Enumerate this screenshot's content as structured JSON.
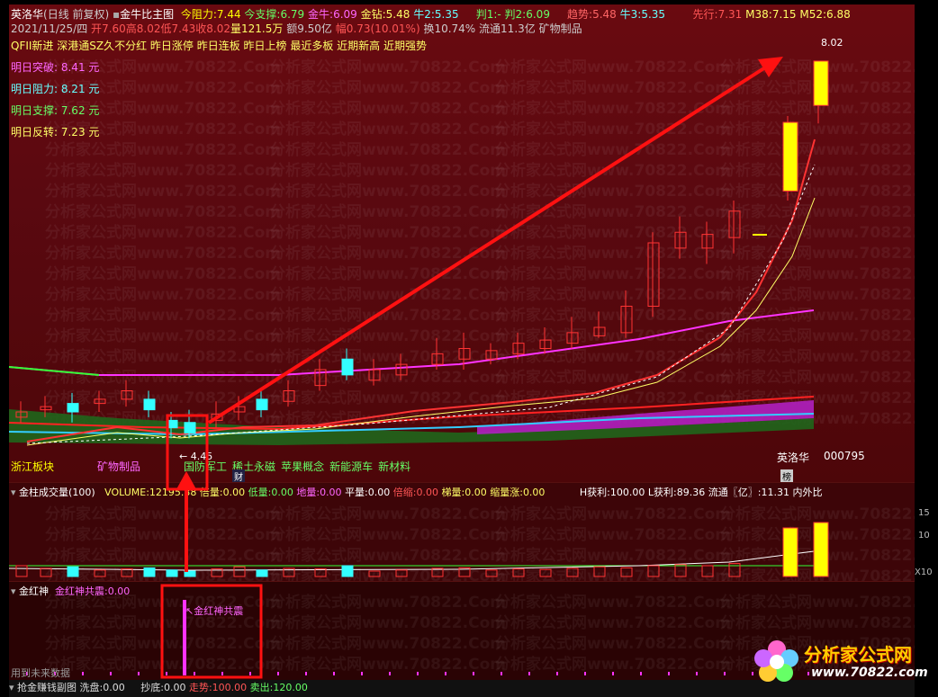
{
  "header": {
    "stock_name": "英洛华",
    "period": "(日线 前复权)",
    "indicator": "金牛比主图",
    "today_resist_label": "今阻力:",
    "today_resist": "7.44",
    "today_support_label": "今支撑:",
    "today_support": "6.79",
    "jinniu_label": "金牛:",
    "jinniu": "6.09",
    "jinzuan_label": "金钻:",
    "jinzuan": "5.48",
    "niu2_label": "牛2:",
    "niu2": "5.35",
    "pan1_label": "判1:",
    "pan1": "-",
    "pan2_label": "判2:",
    "pan2": "6.09",
    "trend_label": "趋势:",
    "trend": "5.48",
    "niu3_label": "牛3:",
    "niu3": "5.35",
    "xianxing_label": "先行:",
    "xianxing": "7.31",
    "m38_label": "M38:",
    "m38": "7.15",
    "m52_label": "M52:",
    "m52": "6.88"
  },
  "quote": {
    "date": "2021/11/25/四",
    "open_label": "开",
    "open": "7.60",
    "high_label": "高",
    "high": "8.02",
    "low_label": "低",
    "low": "7.43",
    "close_label": "收",
    "close": "8.02",
    "vol_label": "量",
    "vol": "121.5万",
    "amount_label": "额",
    "amount": "9.50亿",
    "change_label": "幅",
    "change": "0.73(10.01%)",
    "turnover": "换10.74%",
    "float": "流通11.3亿",
    "sector": "矿物制品"
  },
  "tags": "QFII新进 深港通SZ久不分红 昨日涨停 昨日连板 昨日上榜 最近多板 近期新高 近期强势",
  "levels": [
    {
      "label": "明日突破:",
      "value": "8.41 元",
      "color": "#ff66ff"
    },
    {
      "label": "明日阻力:",
      "value": "8.21 元",
      "color": "#66ffff"
    },
    {
      "label": "明日支撑:",
      "value": "7.62 元",
      "color": "#66ff66"
    },
    {
      "label": "明日反转:",
      "value": "7.23 元",
      "color": "#ffff66"
    }
  ],
  "chart_annot": {
    "price_high": "8.02",
    "low_marker": "← 4.45",
    "stock_tag": "英洛华",
    "stock_code": "000795",
    "badge_cai": "财",
    "badge_bang": "榜"
  },
  "sectors": [
    {
      "label": "浙江板块",
      "color": "#ffff00"
    },
    {
      "label": "矿物制品",
      "color": "#ff66ff"
    },
    {
      "label": "国防军工",
      "color": "#66ff66"
    },
    {
      "label": "稀土永磁",
      "color": "#66ff66"
    },
    {
      "label": "苹果概念",
      "color": "#66ff66"
    },
    {
      "label": "新能源车",
      "color": "#66ff66"
    },
    {
      "label": "新材料",
      "color": "#66ff66"
    }
  ],
  "volume_header": {
    "title": "金柱成交量(100)",
    "volume_label": "VOLUME:",
    "volume": "12195.38",
    "beiliang_label": "倍量:",
    "beiliang": "0.00",
    "diliang_label": "低量:",
    "diliang": "0.00",
    "diliang2_label": "地量:",
    "diliang2": "0.00",
    "pingliang_label": "平量:",
    "pingliang": "0.00",
    "beisuo_label": "倍缩:",
    "beisuo": "0.00",
    "tiliang_label": "梯量:",
    "tiliang": "0.00",
    "suoliang_label": "缩量涨:",
    "suoliang": "0.00",
    "hprofit_label": "H获利:",
    "hprofit": "100.00",
    "lprofit_label": "L获利:",
    "lprofit": "89.36",
    "float_label": "流通〖亿〗:",
    "float": "11.31",
    "neiwai": "内外比"
  },
  "indicator_header": {
    "title": "金红神",
    "signal_label": "金红神共震:",
    "signal": "0.00",
    "annotation": "金红神共震",
    "future_note": "用到未来数据"
  },
  "bottom": {
    "title": "抢金赚钱副图",
    "xipan_label": "洗盘:",
    "xipan": "0.00",
    "chaodi_label": "抄底:",
    "chaodi": "0.00",
    "zoushi_label": "走势:",
    "zoushi": "100.00",
    "maichu_label": "卖出:",
    "maichu": "120.00"
  },
  "axis": {
    "vol_ticks": [
      "15",
      "10",
      "X10"
    ]
  },
  "watermark": "分析家公式网www.70822.Com",
  "logo": {
    "name": "分析家公式网",
    "url": "www.70822.com"
  },
  "colors": {
    "up": "#ff3333",
    "down": "#33ffff",
    "accent": "#ffff00",
    "magenta": "#ff33ff"
  }
}
